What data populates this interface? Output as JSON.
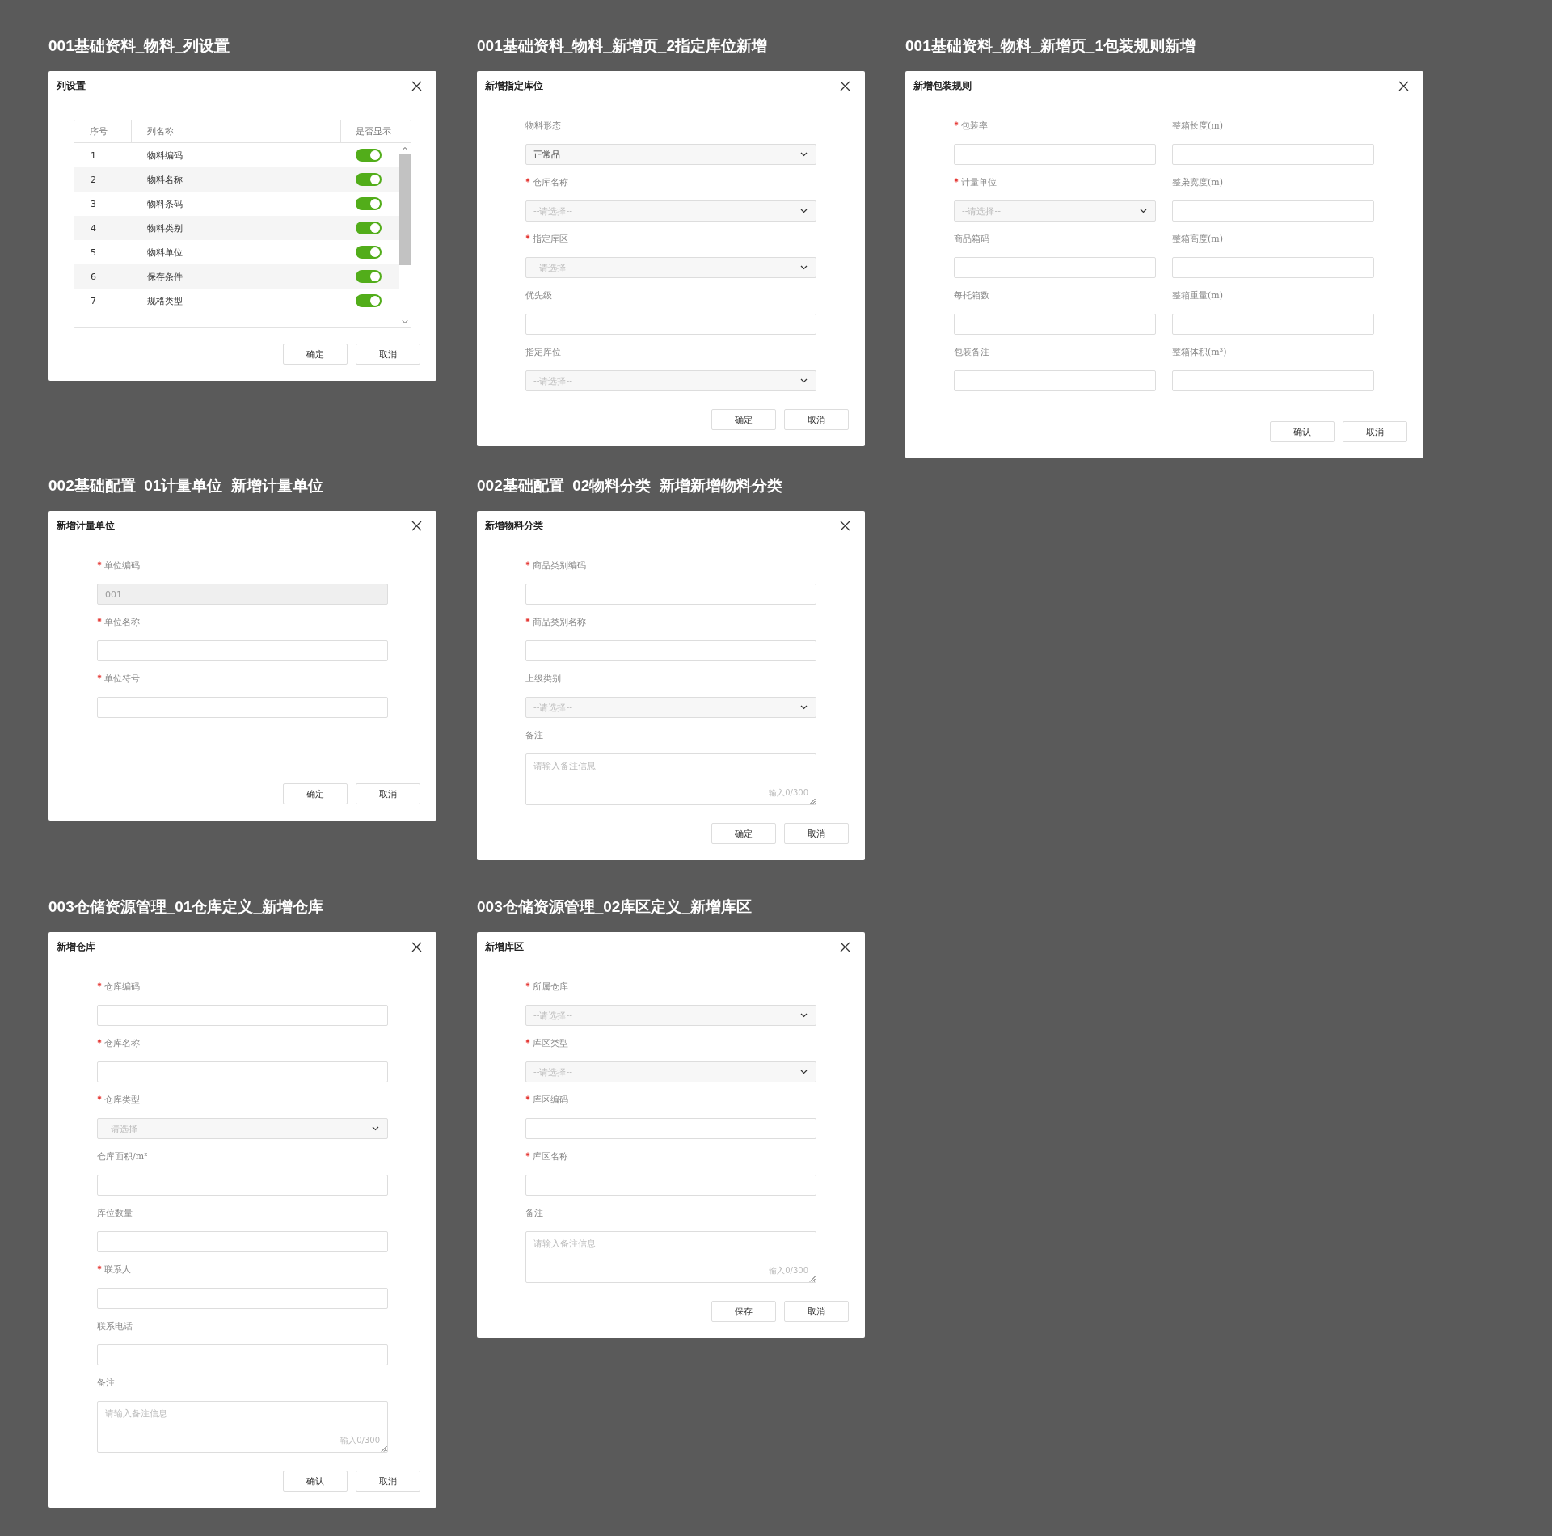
{
  "rows": [
    [
      {
        "heading": "001基础资料_物料_列设置",
        "dialog": {
          "kind": "table",
          "title": "列设置",
          "columns": [
            "序号",
            "列名称",
            "是否显示"
          ],
          "rows": [
            {
              "index": "1",
              "name": "物料编码",
              "on": true
            },
            {
              "index": "2",
              "name": "物料名称",
              "on": true
            },
            {
              "index": "3",
              "name": "物料条码",
              "on": true
            },
            {
              "index": "4",
              "name": "物料类别",
              "on": true
            },
            {
              "index": "5",
              "name": "物料单位",
              "on": true
            },
            {
              "index": "6",
              "name": "保存条件",
              "on": true
            },
            {
              "index": "7",
              "name": "规格类型",
              "on": true
            }
          ],
          "buttons": [
            "确定",
            "取消"
          ]
        }
      },
      {
        "heading": "001基础资料_物料_新增页_2指定库位新增",
        "dialog": {
          "kind": "form",
          "title": "新增指定库位",
          "fields": [
            {
              "label": "物料形态",
              "required": false,
              "kind": "select",
              "value": "正常品"
            },
            {
              "label": "仓库名称",
              "required": true,
              "kind": "select",
              "placeholder": "--请选择--"
            },
            {
              "label": "指定库区",
              "required": true,
              "kind": "select",
              "placeholder": "--请选择--"
            },
            {
              "label": "优先级",
              "required": false,
              "kind": "input",
              "disabled": false
            },
            {
              "label": "指定库位",
              "required": false,
              "kind": "select",
              "placeholder": "--请选择--"
            }
          ],
          "buttons": [
            "确定",
            "取消"
          ]
        }
      },
      {
        "heading": "001基础资料_物料_新增页_1包装规则新增",
        "dialog": {
          "kind": "form_grid",
          "title": "新增包装规则",
          "fields": [
            {
              "label": "包装率",
              "required": true,
              "kind": "input",
              "disabled": false
            },
            {
              "label": "整箱长度(m)",
              "required": false,
              "kind": "input",
              "disabled": false
            },
            {
              "label": "计量单位",
              "required": true,
              "kind": "select",
              "placeholder": "--请选择--"
            },
            {
              "label": "整枭宽度(m)",
              "required": false,
              "kind": "input",
              "disabled": false
            },
            {
              "label": "商品箱码",
              "required": false,
              "kind": "input",
              "disabled": false
            },
            {
              "label": "整箱高度(m)",
              "required": false,
              "kind": "input",
              "disabled": false
            },
            {
              "label": "每托箱数",
              "required": false,
              "kind": "input",
              "disabled": false
            },
            {
              "label": "整箱重量(m)",
              "required": false,
              "kind": "input",
              "disabled": false
            },
            {
              "label": "包装备注",
              "required": false,
              "kind": "input",
              "disabled": false
            },
            {
              "label": "整箱体积(m³)",
              "required": false,
              "kind": "input",
              "disabled": false
            }
          ],
          "buttons": [
            "确认",
            "取消"
          ]
        }
      }
    ],
    [
      {
        "heading": "002基础配置_01计量单位_新增计量单位",
        "dialog": {
          "kind": "form",
          "title": "新增计量单位",
          "fields": [
            {
              "label": "单位编码",
              "required": true,
              "kind": "input",
              "value": "001",
              "disabled": true
            },
            {
              "label": "单位名称",
              "required": true,
              "kind": "input",
              "disabled": false
            },
            {
              "label": "单位符号",
              "required": true,
              "kind": "input",
              "disabled": false
            }
          ],
          "buttons": [
            "确定",
            "取消"
          ]
        }
      },
      {
        "heading": "002基础配置_02物料分类_新增新增物料分类",
        "dialog": {
          "kind": "form",
          "title": "新增物料分类",
          "fields": [
            {
              "label": "商品类别编码",
              "required": true,
              "kind": "input",
              "disabled": false
            },
            {
              "label": "商品类别名称",
              "required": true,
              "kind": "input",
              "disabled": false
            },
            {
              "label": "上级类别",
              "required": false,
              "kind": "select",
              "placeholder": "--请选择--"
            },
            {
              "label": "备注",
              "required": false,
              "kind": "textarea",
              "placeholder": "请输入备注信息",
              "counter": "输入0/300"
            }
          ],
          "buttons": [
            "确定",
            "取消"
          ]
        }
      }
    ],
    [
      {
        "heading": "003仓储资源管理_01仓库定义_新增仓库",
        "dialog": {
          "kind": "form",
          "title": "新增仓库",
          "fields": [
            {
              "label": "仓库编码",
              "required": true,
              "kind": "input",
              "disabled": false
            },
            {
              "label": "仓库名称",
              "required": true,
              "kind": "input",
              "disabled": false
            },
            {
              "label": "仓库类型",
              "required": true,
              "kind": "select",
              "placeholder": "--请选择--"
            },
            {
              "label": "仓库面积/m²",
              "required": false,
              "kind": "input",
              "disabled": false
            },
            {
              "label": "库位数量",
              "required": false,
              "kind": "input",
              "disabled": false
            },
            {
              "label": "联系人",
              "required": true,
              "kind": "input",
              "disabled": false
            },
            {
              "label": "联系电话",
              "required": false,
              "kind": "input",
              "disabled": false
            },
            {
              "label": "备注",
              "required": false,
              "kind": "textarea",
              "placeholder": "请输入备注信息",
              "counter": "输入0/300"
            }
          ],
          "buttons": [
            "确认",
            "取消"
          ]
        }
      },
      {
        "heading": "003仓储资源管理_02库区定义_新增库区",
        "dialog": {
          "kind": "form",
          "title": "新增库区",
          "fields": [
            {
              "label": "所属仓库",
              "required": true,
              "kind": "select",
              "placeholder": "--请选择--"
            },
            {
              "label": "库区类型",
              "required": true,
              "kind": "select",
              "placeholder": "--请选择--"
            },
            {
              "label": "库区编码",
              "required": true,
              "kind": "input",
              "disabled": false
            },
            {
              "label": "库区名称",
              "required": true,
              "kind": "input",
              "disabled": false
            },
            {
              "label": "备注",
              "required": false,
              "kind": "textarea",
              "placeholder": "请输入备注信息",
              "counter": "输入0/300"
            }
          ],
          "buttons": [
            "保存",
            "取消"
          ]
        }
      }
    ]
  ]
}
